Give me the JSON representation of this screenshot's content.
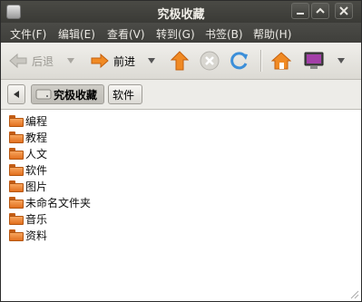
{
  "window": {
    "title": "究极收藏"
  },
  "menu": {
    "items": [
      "文件(F)",
      "编辑(E)",
      "查看(V)",
      "转到(G)",
      "书签(B)",
      "帮助(H)"
    ]
  },
  "toolbar": {
    "back_label": "后退",
    "forward_label": "前进"
  },
  "pathbar": {
    "current": "究极收藏",
    "child": "软件"
  },
  "files": [
    "编程",
    "教程",
    "人文",
    "软件",
    "图片",
    "未命名文件夹",
    "音乐",
    "资料"
  ]
}
